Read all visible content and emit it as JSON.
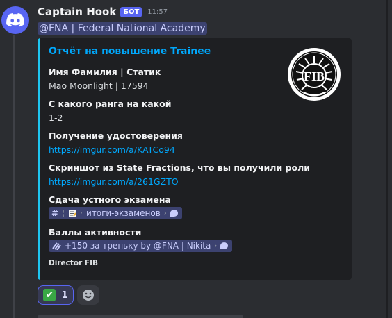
{
  "message": {
    "username": "Captain Hook",
    "bot_badge": "БОТ",
    "timestamp": "11:57",
    "mention": "@FNA | Federal National Academy"
  },
  "embed": {
    "accent_color": "#1ec5f0",
    "title": "Отчёт на повышение Trainee",
    "thumbnail_icon": "fib-seal-icon",
    "thumbnail_text": "FIB",
    "fields": [
      {
        "name": "Имя Фамилия | Статик",
        "value": "Mao Moonlight | 17594"
      },
      {
        "name": "С какого ранга на какой",
        "value": "1-2"
      },
      {
        "name": "Получение удостоверения",
        "value": "https://imgur.com/a/KATCo94"
      },
      {
        "name": "Скриншот из State Fractions, что вы получили роли",
        "value": "https://imgur.com/a/261GZTO"
      },
      {
        "name": "Сдача устного экзамена",
        "channel": "итоги-экзаменов"
      },
      {
        "name": "Баллы активности",
        "channel": "+150 за треньку by @FNA | Nikita"
      }
    ],
    "footer": "Director FIB"
  },
  "reactions": [
    {
      "emoji": "✔",
      "icon": "white-check-mark-icon",
      "count": "1"
    }
  ],
  "add_reaction_icon": "smiley-add-reaction-icon"
}
